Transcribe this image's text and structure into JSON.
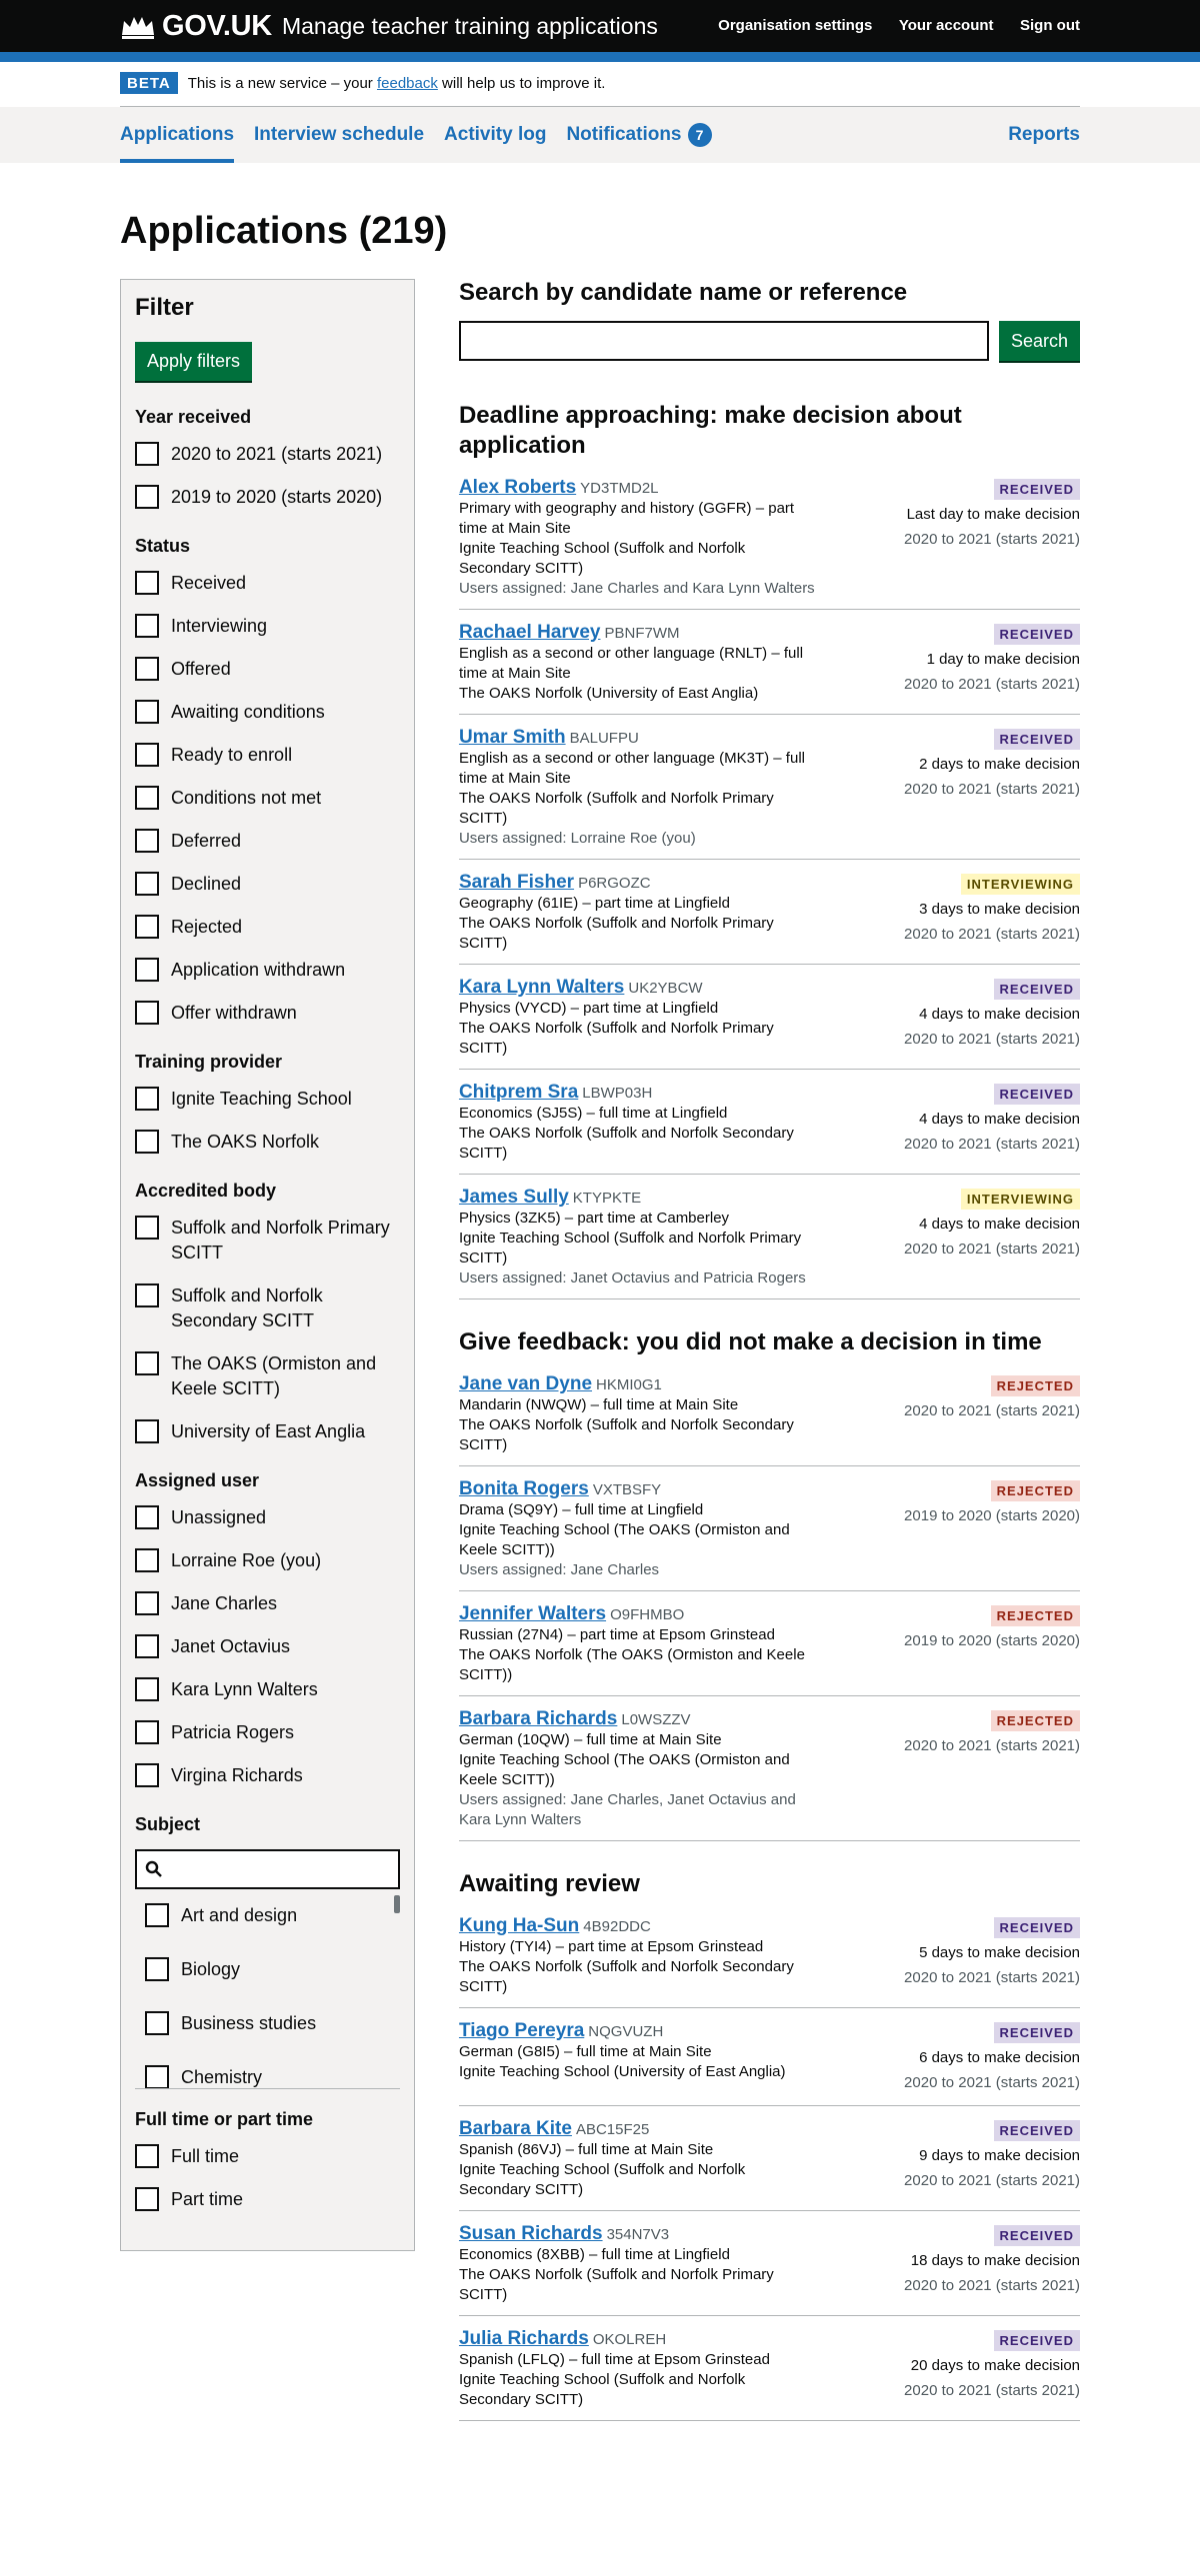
{
  "header": {
    "logo": "GOV.UK",
    "service": "Manage teacher training applications",
    "nav": [
      "Organisation settings",
      "Your account",
      "Sign out"
    ]
  },
  "phase": {
    "tag": "BETA",
    "before": "This is a new service – your ",
    "link": "feedback",
    "after": " will help us to improve it."
  },
  "subnav": {
    "items": [
      "Applications",
      "Interview schedule",
      "Activity log",
      "Notifications"
    ],
    "notifications_count": "7",
    "reports": "Reports"
  },
  "page_title": "Applications (219)",
  "filter": {
    "title": "Filter",
    "apply_label": "Apply filters",
    "groups": [
      {
        "title": "Year received",
        "options": [
          "2020 to 2021 (starts 2021)",
          "2019 to 2020 (starts 2020)"
        ]
      },
      {
        "title": "Status",
        "options": [
          "Received",
          "Interviewing",
          "Offered",
          "Awaiting conditions",
          "Ready to enroll",
          "Conditions not met",
          "Deferred",
          "Declined",
          "Rejected",
          "Application withdrawn",
          "Offer withdrawn"
        ]
      },
      {
        "title": "Training provider",
        "options": [
          "Ignite Teaching School",
          "The OAKS Norfolk"
        ]
      },
      {
        "title": "Accredited body",
        "options": [
          "Suffolk and Norfolk Primary SCITT",
          "Suffolk and Norfolk Secondary SCITT",
          "The OAKS (Ormiston and Keele SCITT)",
          "University of East Anglia"
        ]
      },
      {
        "title": "Assigned user",
        "options": [
          "Unassigned",
          "Lorraine Roe (you)",
          "Jane Charles",
          "Janet Octavius",
          "Kara Lynn Walters",
          "Patricia Rogers",
          "Virgina Richards"
        ]
      }
    ],
    "subject": {
      "title": "Subject",
      "options": [
        "Art and design",
        "Biology",
        "Business studies",
        "Chemistry"
      ]
    },
    "mode": {
      "title": "Full time or part time",
      "options": [
        "Full time",
        "Part time"
      ]
    }
  },
  "search": {
    "title": "Search by candidate name or reference",
    "button": "Search"
  },
  "sections": [
    {
      "title": "Deadline approaching: make decision about application",
      "apps": [
        {
          "name": "Alex Roberts",
          "ref": "YD3TMD2L",
          "course": "Primary with geography and history (GGFR) – part time at Main Site",
          "provider": "Ignite Teaching School (Suffolk and Norfolk Secondary SCITT)",
          "users": "Users assigned: Jane Charles and Kara Lynn Walters",
          "status": "Received",
          "days": "Last day to make decision",
          "year": "2020 to 2021 (starts 2021)"
        },
        {
          "name": "Rachael Harvey",
          "ref": "PBNF7WM",
          "course": "English as a second or other language (RNLT) – full time at Main Site",
          "provider": "The OAKS Norfolk (University of East Anglia)",
          "users": "",
          "status": "Received",
          "days": "1 day to make decision",
          "year": "2020 to 2021 (starts 2021)"
        },
        {
          "name": "Umar Smith",
          "ref": "BALUFPU",
          "course": "English as a second or other language (MK3T) – full time at Main Site",
          "provider": "The OAKS Norfolk (Suffolk and Norfolk Primary SCITT)",
          "users": "Users assigned: Lorraine Roe (you)",
          "status": "Received",
          "days": "2 days to make decision",
          "year": "2020 to 2021 (starts 2021)"
        },
        {
          "name": "Sarah Fisher",
          "ref": "P6RGOZC",
          "course": "Geography (61IE) – part time at Lingfield",
          "provider": "The OAKS Norfolk (Suffolk and Norfolk Primary SCITT)",
          "users": "",
          "status": "Interviewing",
          "days": "3 days to make decision",
          "year": "2020 to 2021 (starts 2021)"
        },
        {
          "name": "Kara Lynn Walters",
          "ref": "UK2YBCW",
          "course": "Physics (VYCD) – part time at Lingfield",
          "provider": "The OAKS Norfolk (Suffolk and Norfolk Primary SCITT)",
          "users": "",
          "status": "Received",
          "days": "4 days to make decision",
          "year": "2020 to 2021 (starts 2021)"
        },
        {
          "name": "Chitprem Sra",
          "ref": "LBWP03H",
          "course": "Economics (SJ5S) – full time at Lingfield",
          "provider": "The OAKS Norfolk (Suffolk and Norfolk Secondary SCITT)",
          "users": "",
          "status": "Received",
          "days": "4 days to make decision",
          "year": "2020 to 2021 (starts 2021)"
        },
        {
          "name": "James Sully",
          "ref": "KTYPKTE",
          "course": "Physics (3ZK5) – part time at Camberley",
          "provider": "Ignite Teaching School (Suffolk and Norfolk Primary SCITT)",
          "users": "Users assigned: Janet Octavius and Patricia Rogers",
          "status": "Interviewing",
          "days": "4 days to make decision",
          "year": "2020 to 2021 (starts 2021)"
        }
      ]
    },
    {
      "title": "Give feedback: you did not make a decision in time",
      "apps": [
        {
          "name": "Jane van Dyne",
          "ref": "HKMI0G1",
          "course": "Mandarin (NWQW) – full time at Main Site",
          "provider": "The OAKS Norfolk (Suffolk and Norfolk Secondary SCITT)",
          "users": "",
          "status": "Rejected",
          "days": "",
          "year": "2020 to 2021 (starts 2021)"
        },
        {
          "name": "Bonita Rogers",
          "ref": "VXTBSFY",
          "course": "Drama (SQ9Y) – full time at Lingfield",
          "provider": "Ignite Teaching School (The OAKS (Ormiston and Keele SCITT))",
          "users": "Users assigned: Jane Charles",
          "status": "Rejected",
          "days": "",
          "year": "2019 to 2020 (starts 2020)"
        },
        {
          "name": "Jennifer Walters",
          "ref": "O9FHMBO",
          "course": "Russian (27N4) – part time at Epsom Grinstead",
          "provider": "The OAKS Norfolk (The OAKS (Ormiston and Keele SCITT))",
          "users": "",
          "status": "Rejected",
          "days": "",
          "year": "2019 to 2020 (starts 2020)"
        },
        {
          "name": "Barbara Richards",
          "ref": "L0WSZZV",
          "course": "German (10QW) – full time at Main Site",
          "provider": "Ignite Teaching School (The OAKS (Ormiston and Keele SCITT))",
          "users": "Users assigned: Jane Charles, Janet Octavius and Kara Lynn Walters",
          "status": "Rejected",
          "days": "",
          "year": "2020 to 2021 (starts 2021)"
        }
      ]
    },
    {
      "title": "Awaiting review",
      "apps": [
        {
          "name": "Kung Ha-Sun",
          "ref": "4B92DDC",
          "course": "History (TYI4) – part time at Epsom Grinstead",
          "provider": "The OAKS Norfolk (Suffolk and Norfolk Secondary SCITT)",
          "users": "",
          "status": "Received",
          "days": "5 days to make decision",
          "year": "2020 to 2021 (starts 2021)"
        },
        {
          "name": "Tiago Pereyra",
          "ref": "NQGVUZH",
          "course": "German (G8I5) – full time at Main Site",
          "provider": "Ignite Teaching School (University of East Anglia)",
          "users": "",
          "status": "Received",
          "days": "6 days to make decision",
          "year": "2020 to 2021 (starts 2021)"
        },
        {
          "name": "Barbara Kite",
          "ref": "ABC15F25",
          "course": "Spanish (86VJ) – full time at Main Site",
          "provider": "Ignite Teaching School (Suffolk and Norfolk Secondary SCITT)",
          "users": "",
          "status": "Received",
          "days": "9 days to make decision",
          "year": "2020 to 2021 (starts 2021)"
        },
        {
          "name": "Susan Richards",
          "ref": "354N7V3",
          "course": "Economics (8XBB) – full time at Lingfield",
          "provider": "The OAKS Norfolk (Suffolk and Norfolk Primary SCITT)",
          "users": "",
          "status": "Received",
          "days": "18 days to make decision",
          "year": "2020 to 2021 (starts 2021)"
        },
        {
          "name": "Julia Richards",
          "ref": "OKOLREH",
          "course": "Spanish (LFLQ) – full time at Epsom Grinstead",
          "provider": "Ignite Teaching School (Suffolk and Norfolk Secondary SCITT)",
          "users": "",
          "status": "Received",
          "days": "20 days to make decision",
          "year": "2020 to 2021 (starts 2021)"
        }
      ]
    }
  ]
}
